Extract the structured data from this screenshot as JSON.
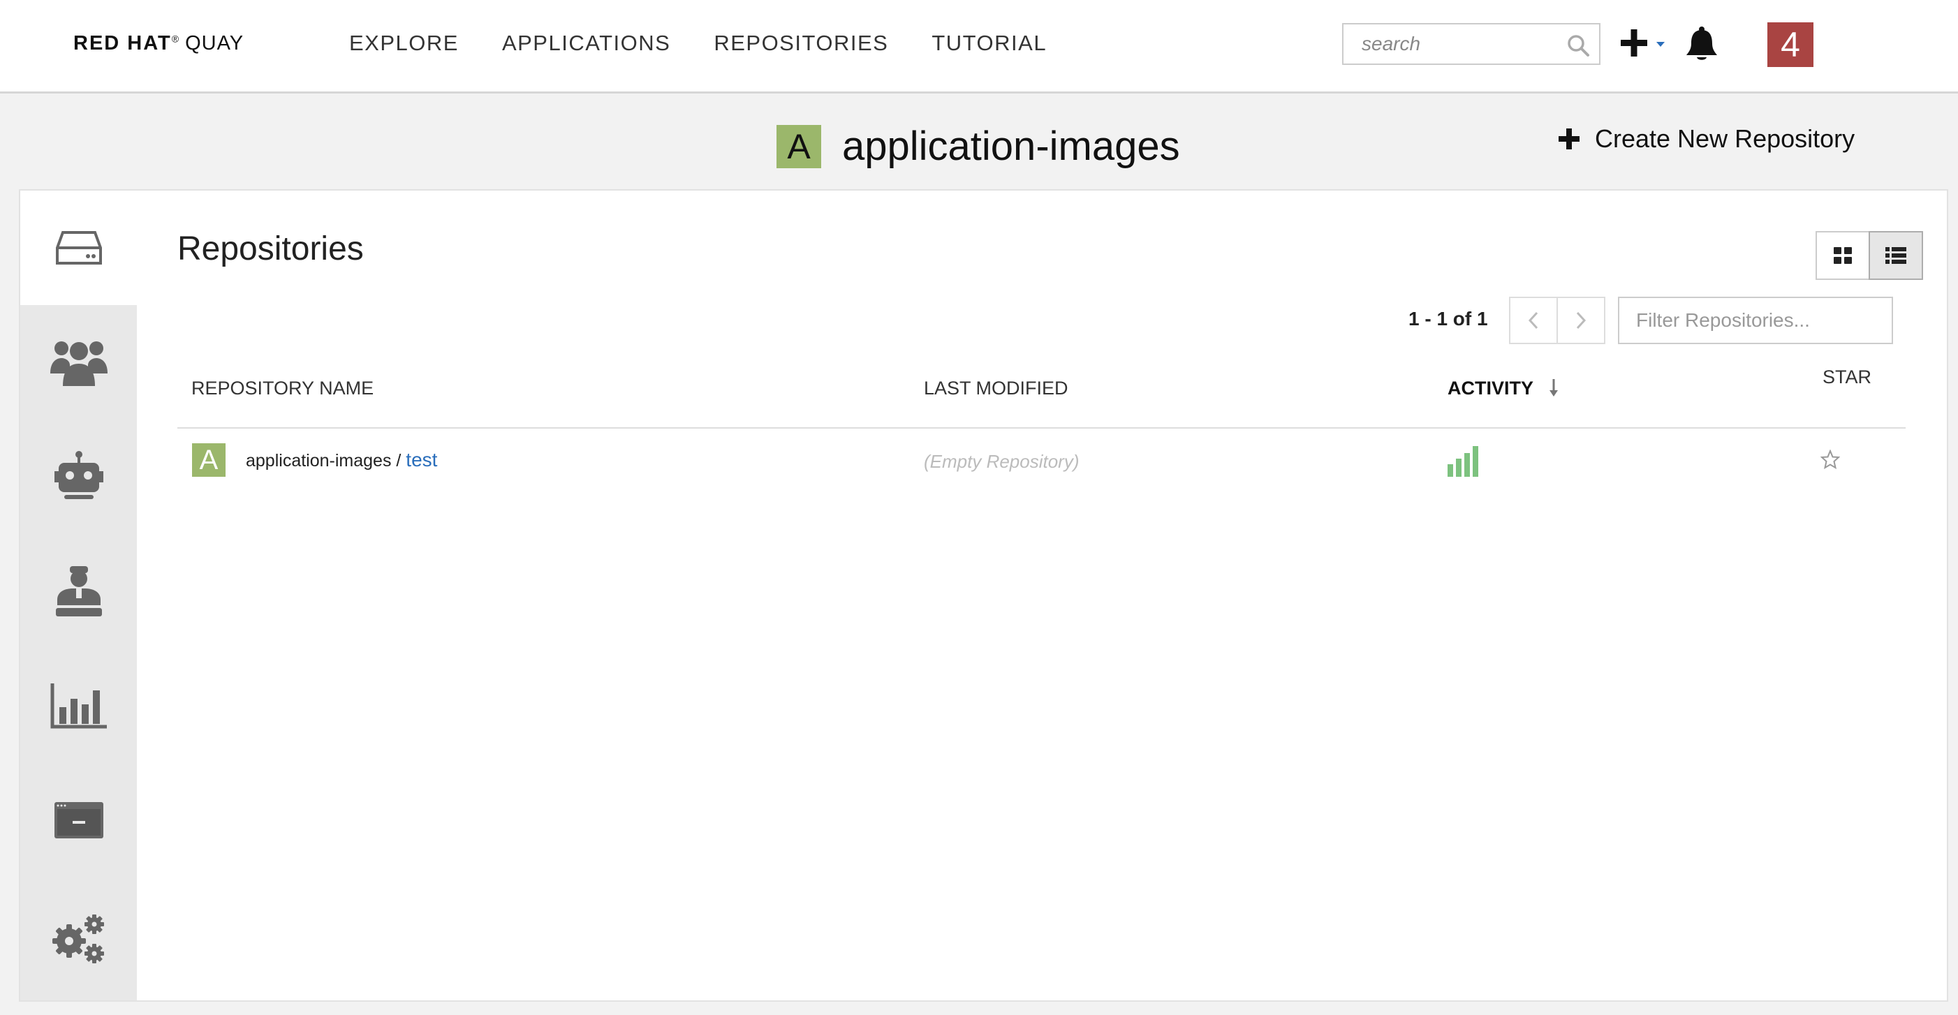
{
  "brand": {
    "red_hat": "RED HAT",
    "reg": "®",
    "product": "QUAY"
  },
  "nav": {
    "links": [
      "EXPLORE",
      "APPLICATIONS",
      "REPOSITORIES",
      "TUTORIAL"
    ]
  },
  "search": {
    "placeholder": "search"
  },
  "user": {
    "badge_text": "4",
    "badge_color": "#a94442"
  },
  "org": {
    "avatar_letter": "A",
    "avatar_color": "#9bb76b",
    "name": "application-images"
  },
  "actions": {
    "create_repo": "Create New Repository"
  },
  "sidebar": {
    "tabs": [
      {
        "icon": "hard-drive-icon",
        "active": true
      },
      {
        "icon": "users-icon",
        "active": false
      },
      {
        "icon": "robot-icon",
        "active": false
      },
      {
        "icon": "user-admin-icon",
        "active": false
      },
      {
        "icon": "bar-chart-icon",
        "active": false
      },
      {
        "icon": "application-window-icon",
        "active": false
      },
      {
        "icon": "gears-icon",
        "active": false
      }
    ]
  },
  "repositories": {
    "title": "Repositories",
    "pagination": "1 - 1 of 1",
    "filter_placeholder": "Filter Repositories...",
    "columns": {
      "name": "REPOSITORY NAME",
      "last_modified": "LAST MODIFIED",
      "activity": "ACTIVITY",
      "star": "STAR"
    },
    "rows": [
      {
        "avatar_letter": "A",
        "namespace": "application-images /",
        "repo": "test",
        "last_modified": "(Empty Repository)",
        "activity_color": "#7dc27f",
        "starred": false
      }
    ]
  }
}
